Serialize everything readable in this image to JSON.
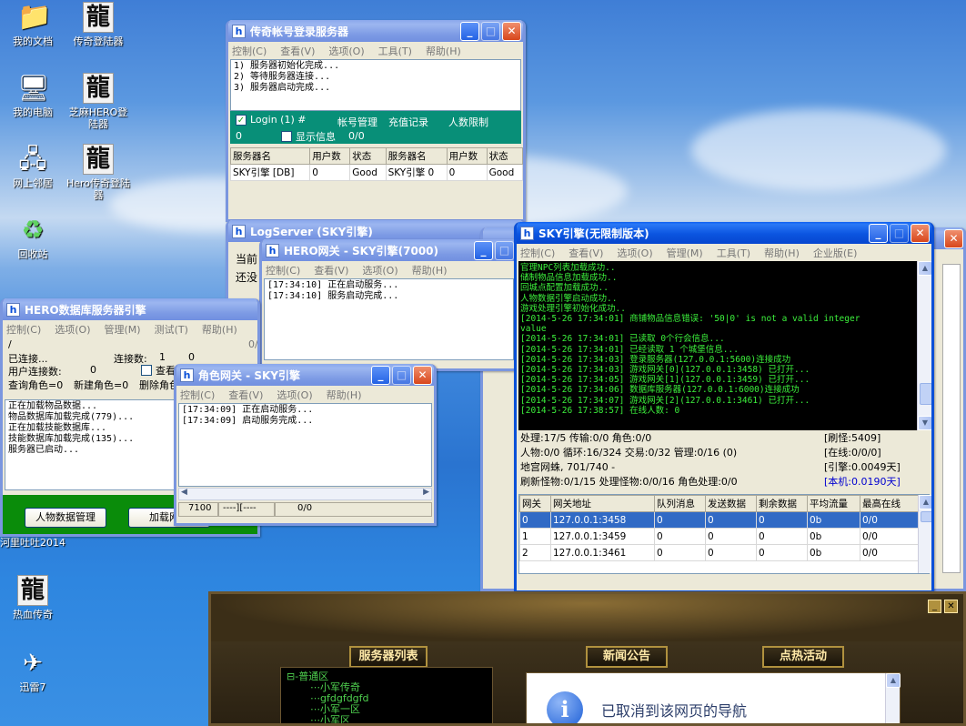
{
  "desktop": {
    "icons": [
      {
        "label": "我的文档",
        "glyph": "📁"
      },
      {
        "label": "传奇登陆器",
        "glyph": "龍"
      },
      {
        "label": "我的电脑",
        "glyph": "🖥"
      },
      {
        "label": "芝麻HERO登陆器",
        "glyph": "龍"
      },
      {
        "label": "网上邻居",
        "glyph": "🖧"
      },
      {
        "label": "Hero传奇登陆器",
        "glyph": "龍"
      },
      {
        "label": "回收站",
        "glyph": "♻"
      },
      {
        "label": "热血传奇",
        "glyph": "龍"
      },
      {
        "label": "迅雷7",
        "glyph": "✈"
      },
      {
        "label": "河里吐吐2014"
      }
    ]
  },
  "login_win": {
    "title": "传奇帐号登录服务器",
    "menu": [
      "控制(C)",
      "查看(V)",
      "选项(O)",
      "工具(T)",
      "帮助(H)"
    ],
    "log": "1) 服务器初始化完成...\n2) 等待服务器连接...\n3) 服务器启动完成...",
    "login_check": "Login (1) #",
    "tabs": [
      "帐号管理",
      "充值记录",
      "人数限制"
    ],
    "count_left": "0",
    "show_info": "显示信息",
    "count_right": "0/0",
    "headers": [
      "服务器名",
      "用户数",
      "状态",
      "服务器名",
      "用户数",
      "状态"
    ],
    "row": [
      "SKY引擎 [DB]",
      "0",
      "Good",
      "SKY引擎 0",
      "0",
      "Good"
    ]
  },
  "log_win": {
    "title": "LogServer (SKY引擎)",
    "line1": "当前",
    "line2": "还没"
  },
  "hero_gate": {
    "title": "HERO网关 - SKY引擎(7000)",
    "menu": [
      "控制(C)",
      "查看(V)",
      "选项(O)",
      "帮助(H)"
    ],
    "log": "[17:34:10] 正在启动服务...\n[17:34:10] 服务启动完成..."
  },
  "db_win": {
    "title": "HERO数据库服务器引擎",
    "menu": [
      "控制(C)",
      "选项(O)",
      "管理(M)",
      "测试(T)",
      "帮助(H)"
    ],
    "slash": "/",
    "zero_right": "0/",
    "connected": "已连接...",
    "conn_count_label": "连接数:",
    "conn_count": "1",
    "conn_count_tail": "0",
    "user_conn_label": "用户连接数:",
    "user_conn": "0",
    "view_check": "查看",
    "query_role": "查询角色=0",
    "new_role": "新建角色=0",
    "delete_role": "删除角色",
    "log": "正在加载物品数据...\n物品数据库加载完成(779)...\n正在加载技能数据库...\n技能数据库加载完成(135)...\n服务器已启动...",
    "btn_people": "人物数据管理",
    "btn_load": "加载网关"
  },
  "role_gate": {
    "title": "角色网关 - SKY引擎",
    "menu": [
      "控制(C)",
      "查看(V)",
      "选项(O)",
      "帮助(H)"
    ],
    "log": "[17:34:09] 正在启动服务...\n[17:34:09] 启动服务完成...",
    "status": [
      "7100",
      "----][----",
      "0/0"
    ]
  },
  "sky_win": {
    "title": "SKY引擎(无限制版本)",
    "menu": [
      "控制(C)",
      "查看(V)",
      "选项(O)",
      "管理(M)",
      "工具(T)",
      "帮助(H)",
      "企业版(E)"
    ],
    "console": "官理NPC列表加载成功..\n储制物品信息加载成功..\n回城点配置加载成功..\n人物数据引擎启动成功..\n游戏处理引擎初始化成功..\n[2014-5-26 17:34:01] 商铺物品信息错误: '50|0' is not a valid integer\nvalue\n[2014-5-26 17:34:01] 已读取 0个行会信息...\n[2014-5-26 17:34:01] 已经读取 1 个城堡信息...\n[2014-5-26 17:34:03] 登录服务器(127.0.0.1:5600)连接成功\n[2014-5-26 17:34:03] 游戏网关[0](127.0.0.1:3458) 已打开...\n[2014-5-26 17:34:05] 游戏网关[1](127.0.0.1:3459) 已打开...\n[2014-5-26 17:34:06] 数据库服务器(127.0.0.1:6000)连接成功\n[2014-5-26 17:34:07] 游戏网关[2](127.0.0.1:3461) 已打开...\n[2014-5-26 17:38:57] 在线人数: 0",
    "stats_left": [
      "处理:17/5 传输:0/0 角色:0/0",
      "人物:0/0 循环:16/324 交易:0/32 管理:0/16 (0)",
      "地宫网蛛, 701/740 -",
      "刷新怪物:0/1/15 处理怪物:0/0/16 角色处理:0/0"
    ],
    "stats_right": [
      "[刷怪:5409]",
      "[在线:0/0/0]",
      "[引擎:0.0049天]",
      "[本机:0.0190天]"
    ],
    "accent": "#0000d0",
    "headers": [
      "网关",
      "网关地址",
      "队列消息",
      "发送数据",
      "剩余数据",
      "平均流量",
      "最高在线"
    ],
    "rows": [
      [
        "0",
        "127.0.0.1:3458",
        "0",
        "0",
        "0",
        "0b",
        "0/0"
      ],
      [
        "1",
        "127.0.0.1:3459",
        "0",
        "0",
        "0",
        "0b",
        "0/0"
      ],
      [
        "2",
        "127.0.0.1:3461",
        "0",
        "0",
        "0",
        "0b",
        "0/0"
      ]
    ]
  },
  "game": {
    "tab_servers": "服务器列表",
    "tab_news": "新闻公告",
    "tab_hot": "点热活动",
    "tree_root": "普通区",
    "tree_items": [
      "小军传奇",
      "gfdgfdgfd",
      "小军一区",
      "小军区"
    ],
    "nav_message": "已取消到该网页的导航",
    "info_glyph": "i"
  }
}
